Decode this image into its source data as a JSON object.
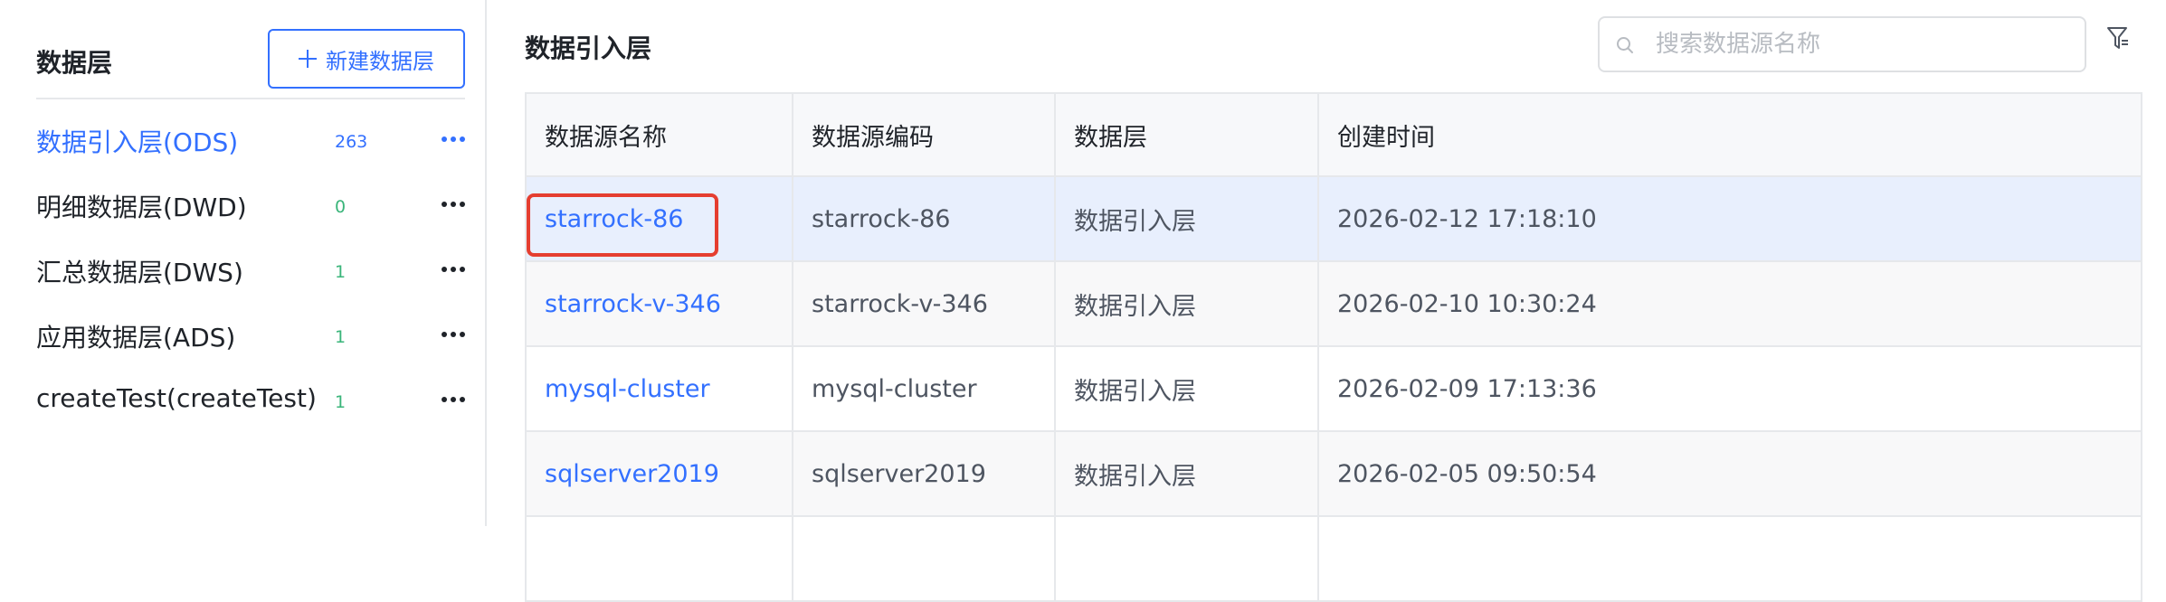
{
  "sidebar": {
    "title": "数据层",
    "new_button_label": "新建数据层",
    "items": [
      {
        "label": "数据引入层(ODS)",
        "count": "263"
      },
      {
        "label": "明细数据层(DWD)",
        "count": "0"
      },
      {
        "label": "汇总数据层(DWS)",
        "count": "1"
      },
      {
        "label": "应用数据层(ADS)",
        "count": "1"
      },
      {
        "label": "createTest(createTest)",
        "count": "1"
      }
    ]
  },
  "main": {
    "title": "数据引入层",
    "search": {
      "placeholder": "搜索数据源名称",
      "value": ""
    },
    "table": {
      "columns": [
        "数据源名称",
        "数据源编码",
        "数据层",
        "创建时间"
      ],
      "rows": [
        {
          "name": "starrock-86",
          "code": "starrock-86",
          "layer": "数据引入层",
          "created": "2026-02-12 17:18:10"
        },
        {
          "name": "starrock-v-346",
          "code": "starrock-v-346",
          "layer": "数据引入层",
          "created": "2026-02-10 10:30:24"
        },
        {
          "name": "mysql-cluster",
          "code": "mysql-cluster",
          "layer": "数据引入层",
          "created": "2026-02-09 17:13:36"
        },
        {
          "name": "sqlserver2019",
          "code": "sqlserver2019",
          "layer": "数据引入层",
          "created": "2026-02-05 09:50:54"
        },
        {
          "name": "",
          "code": "",
          "layer": "",
          "created": ""
        }
      ]
    }
  },
  "colors": {
    "accent": "#3370ff",
    "count_green": "#3ab57a",
    "highlight_red": "#e53e30",
    "selected_row": "#e8effd"
  },
  "icons": [
    "plus-icon",
    "more-icon",
    "search-icon",
    "filter-icon"
  ]
}
